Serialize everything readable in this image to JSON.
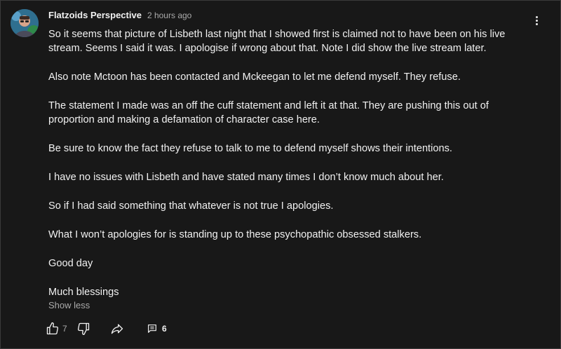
{
  "comment": {
    "author": "Flatzoids Perspective",
    "timestamp": "2 hours ago",
    "paragraphs": [
      "So it seems that picture of Lisbeth last night that I showed first is claimed not to have been on his live stream. Seems I said it was. I apologise if wrong about that. Note I did show the live stream later.",
      "Also note Mctoon has been contacted and Mckeegan to let me defend myself. They refuse.",
      "The statement I made was an off the cuff statement and left it at that. They are pushing this out of proportion and making a defamation of character case here.",
      "Be sure to know the fact they refuse to talk to me to defend myself shows their intentions.",
      "I have no issues with Lisbeth and have stated many times I don’t know much about her.",
      "So if I had said something that whatever is not true I apologies.",
      "What I won’t apologies for is standing up to these psychopathic obsessed stalkers.",
      "Good day",
      "Much blessings"
    ],
    "show_less_label": "Show less",
    "like_count": "7",
    "reply_count": "6"
  },
  "icons": {
    "like": "thumbs-up-icon",
    "dislike": "thumbs-down-icon",
    "share": "share-arrow-icon",
    "replies": "comment-icon",
    "menu": "kebab-menu-icon"
  },
  "colors": {
    "background": "#181818",
    "text": "#f1f1f1",
    "secondary_text": "#aaaaaa"
  }
}
